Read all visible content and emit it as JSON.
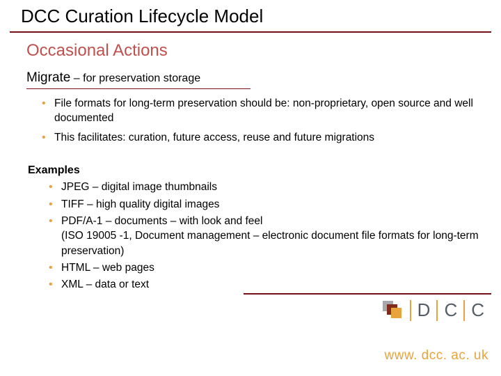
{
  "title": "DCC Curation Lifecycle Model",
  "section_heading": "Occasional Actions",
  "subheading": {
    "main": "Migrate",
    "suffix": " – for preservation storage"
  },
  "bullets": [
    "File formats for long-term preservation should be: non-proprietary, open source and well documented",
    "This facilitates: curation, future access, reuse and future migrations"
  ],
  "examples_title": "Examples",
  "examples": [
    "JPEG – digital image thumbnails",
    "TIFF – high quality digital images",
    "PDF/A-1 – documents – with look and feel\n(ISO 19005 -1, Document management – electronic document file formats for long-term preservation)",
    "HTML – web pages",
    "XML – data or text"
  ],
  "logo": {
    "l1": "D",
    "l2": "C",
    "l3": "C"
  },
  "url": "www. dcc. ac. uk"
}
